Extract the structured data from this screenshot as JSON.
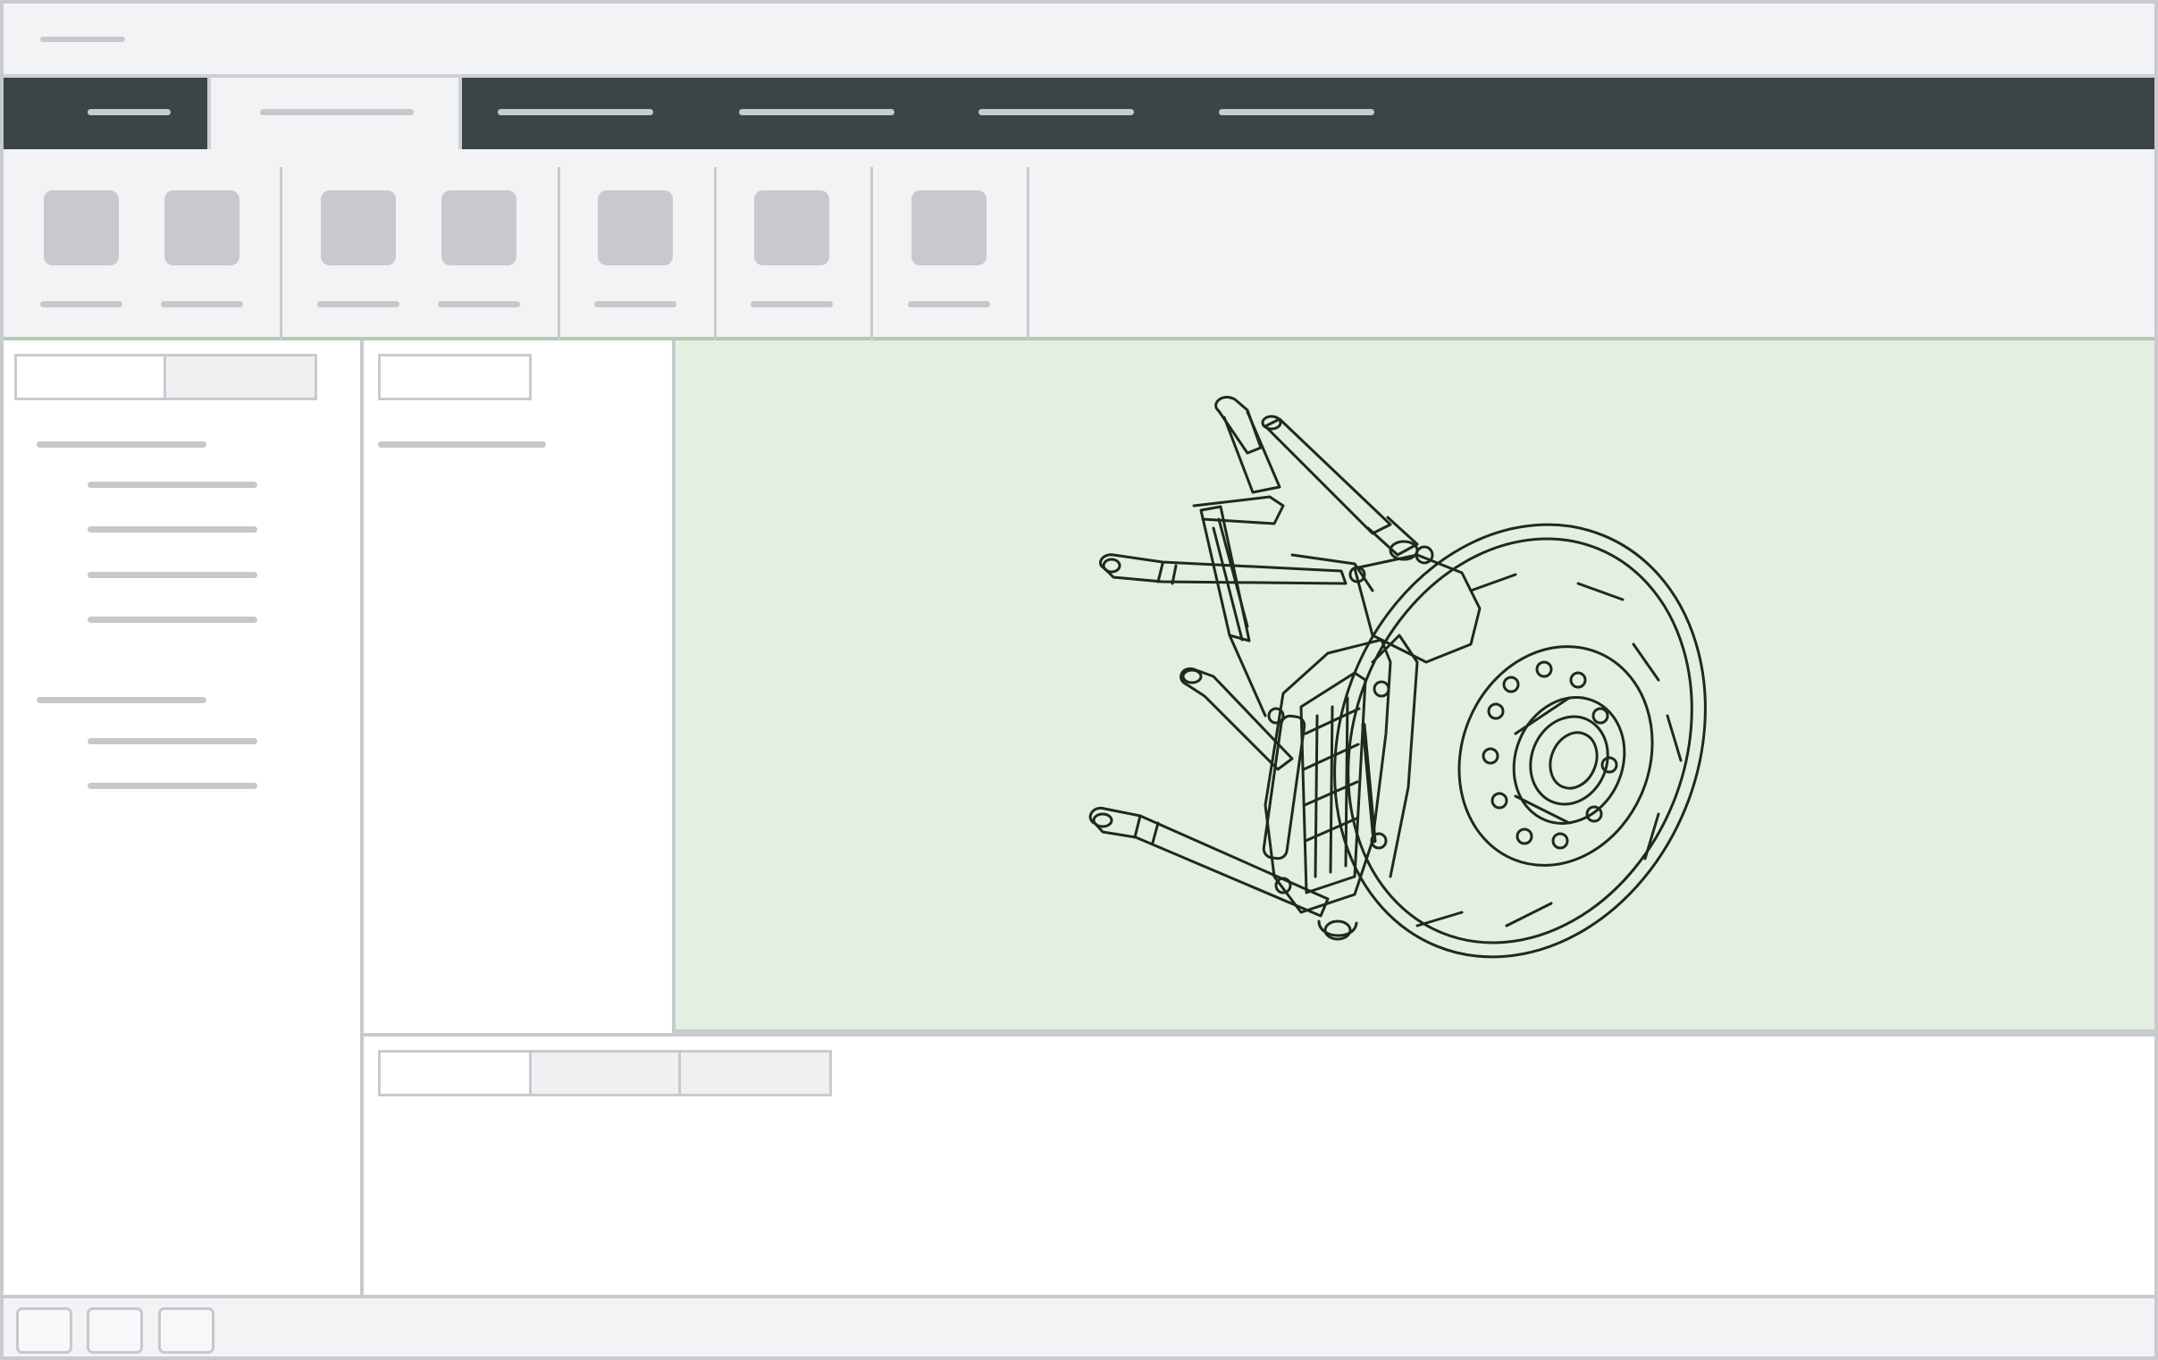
{
  "window": {
    "title": ""
  },
  "menubar": {
    "items": [
      "",
      "",
      "",
      "",
      "",
      ""
    ],
    "active_index": 1
  },
  "ribbon": {
    "tools": [
      "",
      "",
      "",
      "",
      "",
      "",
      ""
    ]
  },
  "left_panel": {
    "tabs": [
      "",
      ""
    ],
    "tree": [
      {
        "label": "",
        "children": [
          "",
          "",
          "",
          ""
        ]
      },
      {
        "label": "",
        "children": [
          "",
          ""
        ]
      }
    ]
  },
  "middle_panel": {
    "tab": "",
    "heading": ""
  },
  "viewport": {
    "model": "brake-hub-assembly"
  },
  "bottom_panel": {
    "tabs": [
      "",
      "",
      ""
    ]
  },
  "statusbar": {
    "buttons": [
      "",
      "",
      ""
    ]
  },
  "colors": {
    "menubar": "#3b4446",
    "viewport": "#e3efe0",
    "chrome": "#f2f3f5",
    "placeholder": "#c7c8cc"
  }
}
